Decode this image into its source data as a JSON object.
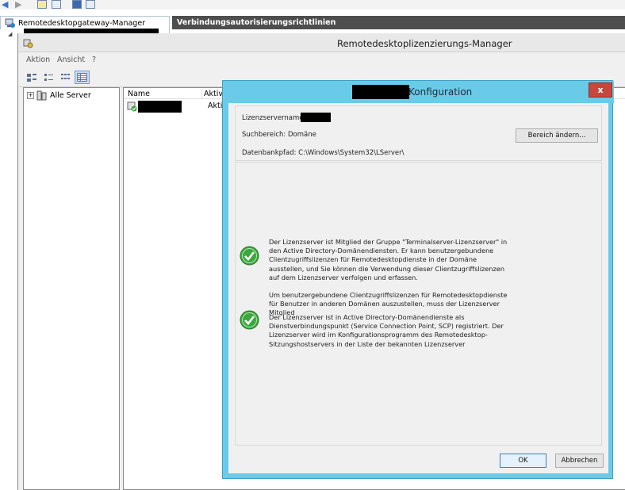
{
  "tabs": {
    "gateway_label": "Remotedesktopgateway-Manager",
    "connection_label": "Verbindungsautorisierungsrichtlinien"
  },
  "mmc": {
    "title": "Remotedesktoplizenzierungs-Manager",
    "menu": [
      "Aktion",
      "Ansicht",
      "?"
    ],
    "tree": {
      "root_label": "Alle Server"
    },
    "list": {
      "columns": [
        "Name",
        "Aktiv"
      ],
      "rows": [
        {
          "status": "Aktiv"
        }
      ]
    }
  },
  "dialog": {
    "title": "Konfiguration",
    "close_glyph": "x",
    "license_server_label": "Lizenzservername:",
    "search_scope_label": "Suchbereich: Domäne",
    "database_path_label": "Datenbankpfad: C:\\Windows\\System32\\LServer\\",
    "change_scope_button": "Bereich ändern...",
    "messages": {
      "group_membership": "Der Lizenzserver ist Mitglied der Gruppe \"Terminalserver-Lizenzserver\" in den Active Directory-Domänendiensten. Er kann benutzergebundene Clientzugriffslizenzen für Remotedesktopdienste in der Domäne ausstellen, und Sie können die Verwendung dieser Clientzugriffslizenzen auf dem Lizenzserver verfolgen und erfassen.",
      "other_domains": "Um benutzergebundene Clientzugriffslizenzen für Remotedesktopdienste für Benutzer in anderen Domänen auszustellen, muss der Lizenzserver Mitglied",
      "scp_registered": "Der Lizenzserver ist in Active Directory-Domänendienste als Dienstverbindungspunkt (Service Connection Point, SCP) registriert. Der Lizenzserver wird im Konfigurationsprogramm des Remotedesktop-Sitzungshostservers in der Liste der bekannten Lizenzserver"
    },
    "ok_button": "OK",
    "cancel_button": "Abbrechen"
  },
  "colors": {
    "dialog_frame": "#6acbe8",
    "close_button": "#c8473d",
    "check_green": "#3aa83a",
    "tab_dark": "#4e4e4e"
  }
}
